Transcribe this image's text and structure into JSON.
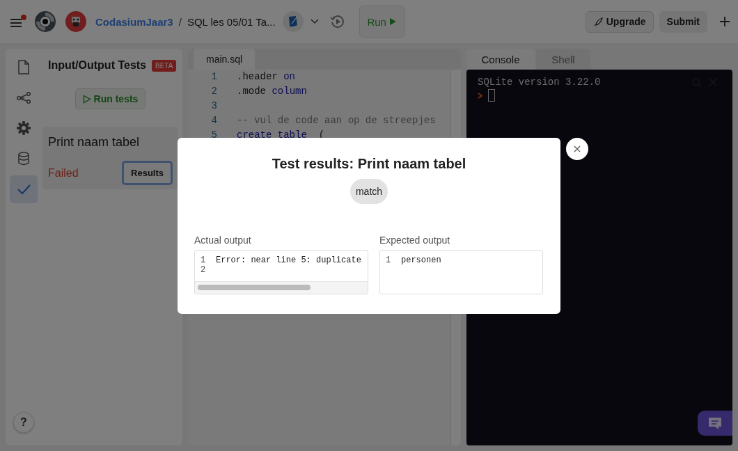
{
  "topbar": {
    "menu_notification": true,
    "user": "CodasiumJaar3",
    "separator": "/",
    "project": "SQL les 05/01 Ta...",
    "run_label": "Run",
    "upgrade_label": "Upgrade",
    "submit_label": "Submit"
  },
  "sidebar": {
    "items": [
      {
        "kind": "file",
        "selected": false
      },
      {
        "kind": "graph",
        "selected": false
      },
      {
        "kind": "settings",
        "selected": false
      },
      {
        "kind": "database",
        "selected": false
      },
      {
        "kind": "check",
        "selected": true
      }
    ],
    "help_label": "?"
  },
  "tests": {
    "title": "Input/Output Tests",
    "badge": "BETA",
    "run_button": "Run tests",
    "cases": [
      {
        "name": "Print naam tabel",
        "status": "Failed",
        "passed": false,
        "results_button": "Results",
        "focused": true
      }
    ]
  },
  "editor": {
    "tabs": [
      {
        "label": "main.sql",
        "selected": true
      }
    ],
    "lines": [
      {
        "number": "1",
        "tokens": [
          {
            "kind": "plain",
            "text": ".header "
          },
          {
            "kind": "keyword",
            "text": "on"
          }
        ]
      },
      {
        "number": "2",
        "tokens": [
          {
            "kind": "plain",
            "text": ".mode "
          },
          {
            "kind": "keyword",
            "text": "column"
          }
        ]
      },
      {
        "number": "3"
      },
      {
        "number": "4",
        "tokens": [
          {
            "kind": "comment",
            "text": "-- vul de code aan op de streepjes"
          }
        ]
      },
      {
        "number": "5",
        "tokens": [
          {
            "kind": "keyword",
            "text": "create table"
          },
          {
            "kind": "plain",
            "text": "  ("
          }
        ]
      }
    ]
  },
  "console": {
    "tabs": [
      {
        "label": "Console",
        "selected": true
      },
      {
        "label": "Shell",
        "selected": false
      }
    ],
    "lines": [
      "SQLite version 3.22.0"
    ]
  },
  "modal": {
    "title": "Test results: Print naam tabel",
    "match_label": "match",
    "actual": {
      "label": "Actual output",
      "lines": [
        {
          "number": "1",
          "text": "Error: near line 5: duplicate"
        },
        {
          "number": "2"
        }
      ]
    },
    "expected": {
      "label": "Expected output",
      "lines": [
        {
          "number": "1",
          "text": "personen"
        }
      ]
    }
  }
}
